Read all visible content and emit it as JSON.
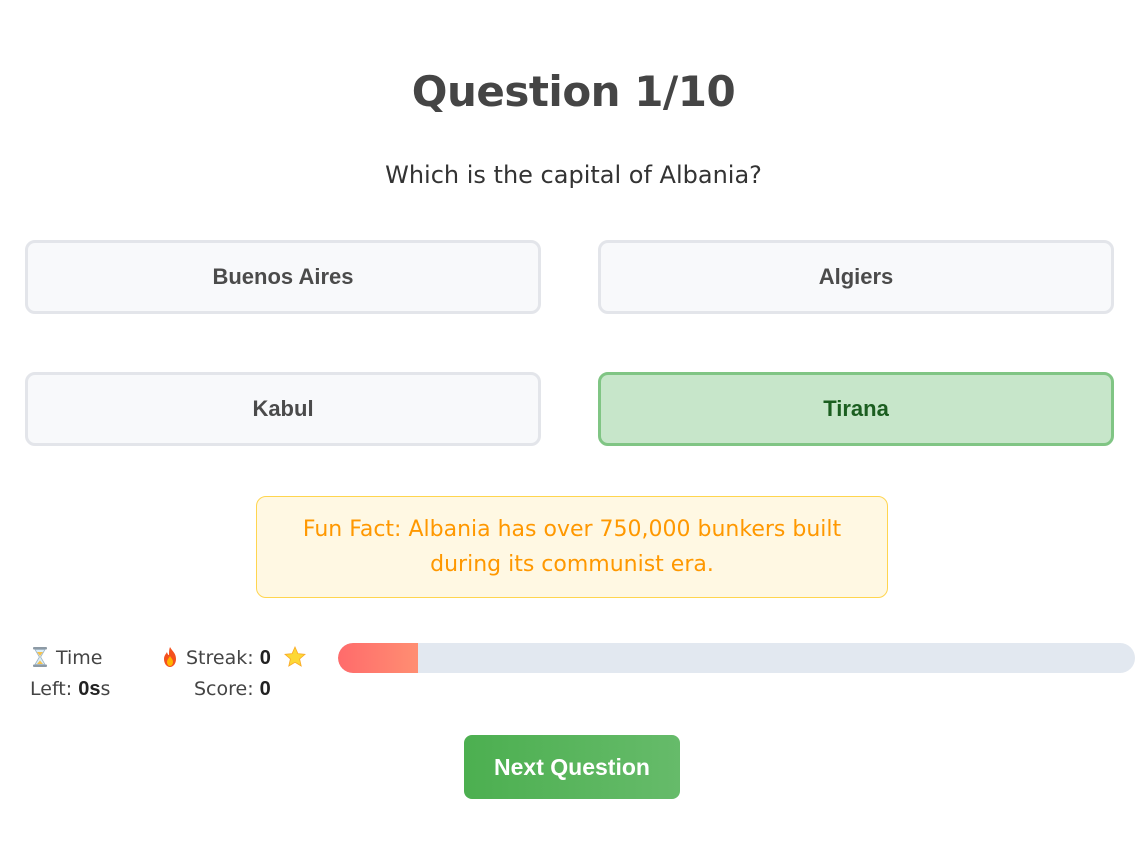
{
  "quiz": {
    "title": "Question 1/10",
    "question": "Which is the capital of Albania?",
    "options": [
      {
        "label": "Buenos Aires",
        "state": "default"
      },
      {
        "label": "Algiers",
        "state": "default"
      },
      {
        "label": "Kabul",
        "state": "default"
      },
      {
        "label": "Tirana",
        "state": "correct"
      }
    ],
    "fun_fact": "Fun Fact: Albania has over 750,000 bunkers built during its communist era."
  },
  "stats": {
    "time_label_1": "Time",
    "time_label_2": "Left:",
    "time_value": "0s",
    "time_suffix": "s",
    "streak_label": "Streak:",
    "streak_value": "0",
    "score_label": "Score:",
    "score_value": "0",
    "icons": {
      "time": "hourglass-icon",
      "streak": "fire-icon",
      "score": "star-icon"
    }
  },
  "progress": {
    "fraction": 0.1
  },
  "actions": {
    "next_label": "Next Question"
  },
  "colors": {
    "correct_bg": "#c7e6ca",
    "correct_border": "#80c584",
    "correct_text": "#1b5e20",
    "fact_bg": "#fff8e3",
    "fact_text": "#ff9800",
    "button_green": "#4caf50",
    "progress_fill": "#ff6b6b"
  }
}
